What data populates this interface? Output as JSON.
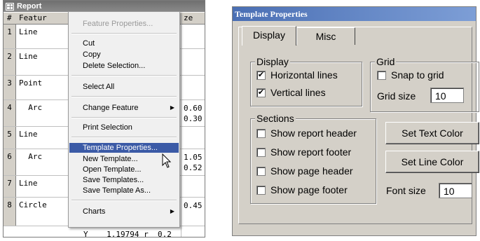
{
  "report": {
    "title": "Report",
    "columns": {
      "num": "#",
      "feature": "Featur",
      "size": "ze"
    },
    "rows": [
      {
        "num": "1",
        "name": "Line",
        "v1": "",
        "v2": ""
      },
      {
        "num": "2",
        "name": "Line",
        "v1": "",
        "v2": ""
      },
      {
        "num": "3",
        "name": "Point",
        "v1": "",
        "v2": ""
      },
      {
        "num": "4",
        "name": "  Arc",
        "v1": "0.60",
        "v2": "0.30"
      },
      {
        "num": "5",
        "name": "Line",
        "v1": "",
        "v2": ""
      },
      {
        "num": "6",
        "name": "  Arc",
        "v1": "1.05",
        "v2": "0.52"
      },
      {
        "num": "7",
        "name": "Line",
        "v1": "",
        "v2": ""
      },
      {
        "num": "8",
        "name": "Circle",
        "v1": "0.45",
        "v2": ""
      }
    ],
    "bottom_row": "Y    1.19794 r  0.2"
  },
  "menu": {
    "items": [
      {
        "label": "Feature Properties...",
        "disabled": true
      },
      {
        "label": "Cut"
      },
      {
        "label": "Copy"
      },
      {
        "label": "Delete Selection..."
      },
      {
        "label": "Select All"
      },
      {
        "label": "Change Feature",
        "submenu": true
      },
      {
        "label": "Print Selection"
      },
      {
        "label": "Template Properties...",
        "selected": true
      },
      {
        "label": "New Template..."
      },
      {
        "label": "Open Template..."
      },
      {
        "label": "Save Templates..."
      },
      {
        "label": "Save Template As..."
      },
      {
        "label": "Charts",
        "submenu": true
      }
    ]
  },
  "dialog": {
    "title": "Template Properties",
    "tabs": [
      "Display",
      "Misc"
    ],
    "display_group": {
      "label": "Display",
      "horizontal_lines": {
        "label": "Horizontal lines",
        "checked": true
      },
      "vertical_lines": {
        "label": "Vertical lines",
        "checked": true
      }
    },
    "grid_group": {
      "label": "Grid",
      "snap_to_grid": {
        "label": "Snap to grid",
        "checked": false
      },
      "grid_size_label": "Grid size",
      "grid_size_value": "10"
    },
    "sections_group": {
      "label": "Sections",
      "items": [
        {
          "label": "Show report header",
          "checked": false
        },
        {
          "label": "Show report footer",
          "checked": false
        },
        {
          "label": "Show page header",
          "checked": false
        },
        {
          "label": "Show page footer",
          "checked": false
        }
      ]
    },
    "buttons": {
      "set_text_color": "Set Text Color",
      "set_line_color": "Set Line Color"
    },
    "font_size_label": "Font size",
    "font_size_value": "10"
  },
  "colors": {
    "menu_highlight": "#3b5aa6",
    "dialog_title": "#4a6fb4",
    "dialog_face": "#d4d0c8"
  }
}
